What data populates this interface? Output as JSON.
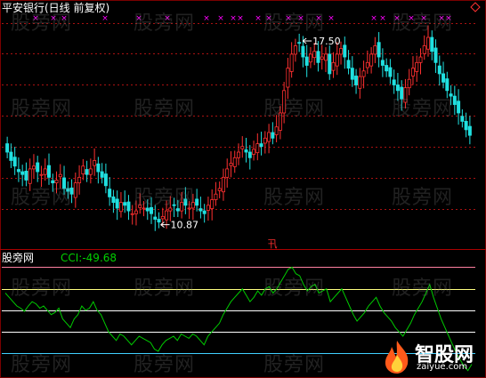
{
  "main_chart": {
    "title": "平安银行(日线 前复权)",
    "high_annotation": "17.50",
    "low_annotation": "10.87",
    "marker": "卂"
  },
  "sub_chart": {
    "title": "股旁网",
    "indicator": "CCI:",
    "indicator_value": "-49.68"
  },
  "watermark_text": "股旁网",
  "logo": {
    "name": "智股网",
    "url": "zaiyue.com"
  },
  "colors": {
    "up": "#ff3030",
    "down": "#20e0e0",
    "cci_line": "#00cc00",
    "grid": "#aa1111",
    "level_top": "#ff80a0",
    "level_mid": "#ffff80",
    "level_zero": "#ffffff",
    "level_bottom": "#40d0ff",
    "x_marker": "#ff00ff",
    "annotation": "#ffffff"
  },
  "chart_data": [
    {
      "type": "candlestick",
      "title": "平安银行(日线 前复权)",
      "price_range": [
        10.0,
        18.2
      ],
      "annotations": [
        {
          "label": "17.50",
          "value": 17.5
        },
        {
          "label": "10.87",
          "value": 10.87
        }
      ],
      "close": [
        13.4,
        13.1,
        12.9,
        12.7,
        12.6,
        12.4,
        12.8,
        12.9,
        12.7,
        12.6,
        12.8,
        12.5,
        12.3,
        12.4,
        12.6,
        12.1,
        12.0,
        11.9,
        12.3,
        12.5,
        12.9,
        12.6,
        12.8,
        13.1,
        12.7,
        12.5,
        12.2,
        11.8,
        11.6,
        11.4,
        11.6,
        11.5,
        11.3,
        11.2,
        11.3,
        11.5,
        11.4,
        11.3,
        11.2,
        11.0,
        10.9,
        11.1,
        11.3,
        11.4,
        11.5,
        11.3,
        11.6,
        11.5,
        11.4,
        11.6,
        11.5,
        11.3,
        11.2,
        11.5,
        11.7,
        11.9,
        12.1,
        12.5,
        12.8,
        13.0,
        13.2,
        13.4,
        13.6,
        13.4,
        13.2,
        13.5,
        13.7,
        13.6,
        13.9,
        14.1,
        13.9,
        14.3,
        14.8,
        15.6,
        16.4,
        16.9,
        17.2,
        17.3,
        16.8,
        16.5,
        16.9,
        17.0,
        16.6,
        16.8,
        16.9,
        16.2,
        16.6,
        16.9,
        17.1,
        16.8,
        16.4,
        16.0,
        15.8,
        16.1,
        16.3,
        16.6,
        16.9,
        17.2,
        16.8,
        16.5,
        16.3,
        16.1,
        15.8,
        15.6,
        15.3,
        15.7,
        16.0,
        16.4,
        16.6,
        16.8,
        17.2,
        17.5,
        17.0,
        16.6,
        16.2,
        15.9,
        15.6,
        15.4,
        15.1,
        14.8,
        14.5,
        14.2,
        14.0
      ],
      "cci_range": [
        -310,
        210
      ],
      "cci_levels": [
        200,
        100,
        0,
        -100,
        -200
      ],
      "cci": [
        80,
        60,
        40,
        20,
        10,
        -5,
        20,
        40,
        30,
        10,
        20,
        0,
        -20,
        -10,
        10,
        -40,
        -60,
        -80,
        -40,
        -20,
        20,
        0,
        10,
        40,
        0,
        -20,
        -60,
        -100,
        -120,
        -140,
        -110,
        -120,
        -140,
        -160,
        -140,
        -120,
        -130,
        -140,
        -150,
        -180,
        -190,
        -160,
        -140,
        -130,
        -120,
        -140,
        -110,
        -120,
        -130,
        -110,
        -120,
        -140,
        -160,
        -120,
        -100,
        -80,
        -60,
        -20,
        10,
        40,
        60,
        80,
        100,
        70,
        40,
        60,
        90,
        70,
        100,
        110,
        80,
        100,
        130,
        160,
        190,
        200,
        170,
        160,
        120,
        90,
        110,
        120,
        80,
        90,
        100,
        40,
        60,
        80,
        100,
        60,
        20,
        -20,
        -50,
        -30,
        -10,
        20,
        40,
        60,
        20,
        -10,
        -30,
        -50,
        -80,
        -100,
        -120,
        -90,
        -60,
        -20,
        10,
        40,
        80,
        120,
        60,
        10,
        -40,
        -80,
        -120,
        -160,
        -200,
        -230,
        -260,
        -280,
        -250
      ]
    }
  ]
}
